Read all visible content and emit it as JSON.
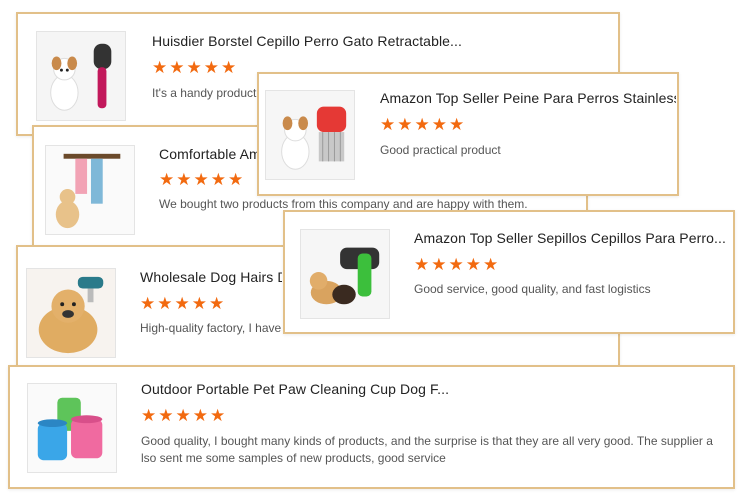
{
  "colors": {
    "border": "#e2c089",
    "star": "#f26a10",
    "title": "#222222",
    "review": "#555555"
  },
  "reviews": [
    {
      "title": "Huisdier Borstel Cepillo Perro Gato Retractable...",
      "rating": 5,
      "text": "It's a handy product",
      "image": "dog-and-slicker-brush"
    },
    {
      "title": "Comfortable Am",
      "rating": 5,
      "text": "We bought two products from this company and are happy with them.",
      "image": "dog-towel-hanger"
    },
    {
      "title": "Wholesale Dog Hairs D",
      "rating": 5,
      "text": "High-quality factory, I have",
      "image": "golden-retriever-grooming"
    },
    {
      "title": "Outdoor Portable Pet Paw Cleaning Cup Dog F...",
      "rating": 5,
      "text": "Good quality, I bought many kinds of products, and the surprise is that they are all very good. The supplier also sent me some samples of new products, good service",
      "text_line1": "Good quality, I bought many kinds of products, and the surprise is that they are all very good. The supplier a",
      "text_line2": "lso sent me some samples of new products, good service",
      "image": "paw-cleaning-cups"
    },
    {
      "title": "Amazon Top Seller Peine Para Perros Stainless...",
      "rating": 5,
      "text": "Good practical product",
      "image": "dog-and-flea-comb"
    },
    {
      "title": "Amazon Top Seller Sepillos Cepillos Para Perro...",
      "rating": 5,
      "text": "Good service, good quality, and fast logistics",
      "image": "cat-dog-self-cleaning-brush"
    }
  ]
}
